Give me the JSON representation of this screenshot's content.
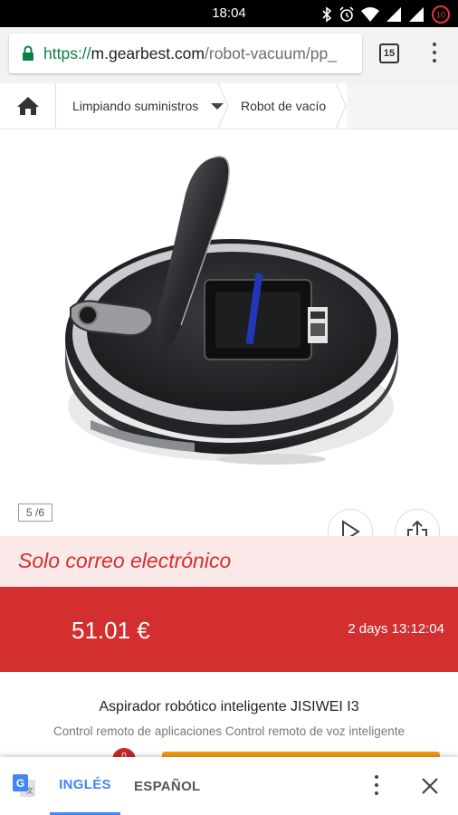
{
  "status_bar": {
    "time": "18:04",
    "battery_level": "10"
  },
  "browser": {
    "url_scheme": "https://",
    "url_host": "m.gearbest.com",
    "url_path": "/robot-vacuum/pp_",
    "tab_count": "15"
  },
  "breadcrumb": {
    "category": "Limpiando suministros",
    "current": "Robot de vacío"
  },
  "gallery": {
    "counter": "5 /6"
  },
  "promo": {
    "text": "Solo correo electrónico"
  },
  "price_bar": {
    "price": "51.01 €",
    "countdown": "2 days 13:12:04"
  },
  "product": {
    "title": "Aspirador robótico inteligente JISIWEI I3",
    "subtitle": "Control remoto de aplicaciones Control remoto de voz inteligente"
  },
  "cart_badge": "0",
  "translate_bar": {
    "lang_from": "INGLÉS",
    "lang_to": "ESPAÑOL"
  },
  "colors": {
    "accent_red": "#d32f2f",
    "promo_bg": "#fbe8e8",
    "translate_blue": "#4285f4",
    "buy_orange": "#f39c12"
  }
}
